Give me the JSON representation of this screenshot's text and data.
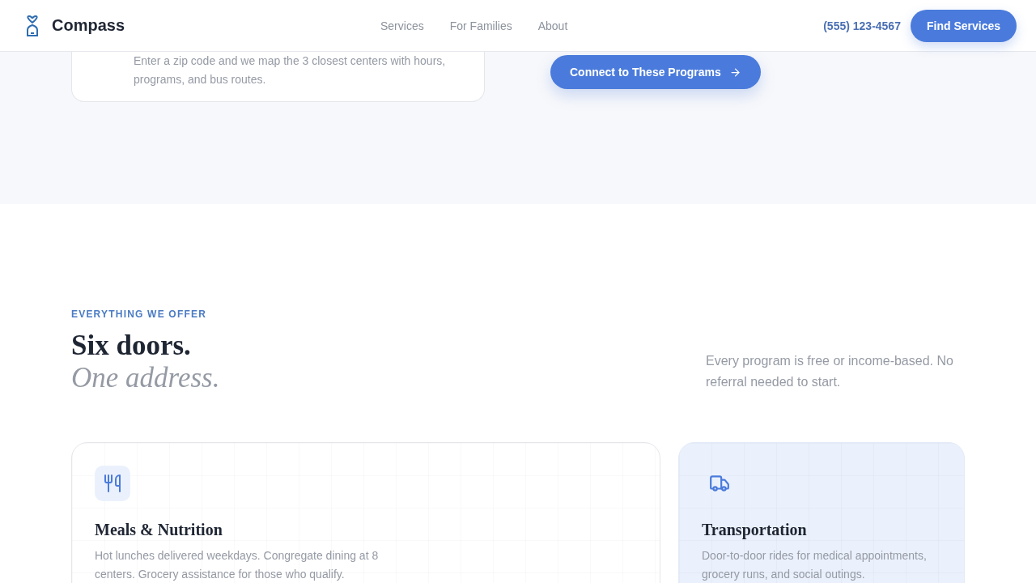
{
  "header": {
    "brand": "Compass",
    "nav": [
      {
        "label": "Services"
      },
      {
        "label": "For Families"
      },
      {
        "label": "About"
      }
    ],
    "phone": "(555) 123-4567",
    "cta": "Find Services"
  },
  "intro": {
    "card_text": "Enter a zip code and we map the 3 closest centers with hours, programs, and bus routes.",
    "button": "Connect to These Programs"
  },
  "offer": {
    "eyebrow": "EVERYTHING WE OFFER",
    "title": "Six doors.",
    "subtitle": "One address.",
    "note": "Every program is free or income-based. No referral needed to start.",
    "cards": [
      {
        "kind": "meals",
        "title": "Meals & Nutrition",
        "text": "Hot lunches delivered weekdays. Congregate dining at 8 centers. Grocery assistance for those who qualify."
      },
      {
        "kind": "transport",
        "title": "Transportation",
        "text": "Door-to-door rides for medical appointments, grocery runs, and social outings."
      }
    ]
  }
}
